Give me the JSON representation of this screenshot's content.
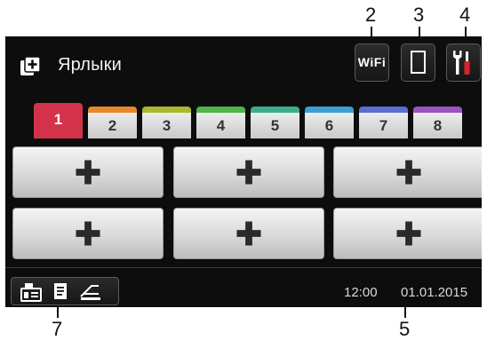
{
  "callouts": {
    "wifi": "2",
    "status": "3",
    "settings": "4",
    "datetime": "5",
    "modes": "7"
  },
  "header": {
    "title": "Ярлыки",
    "wifi_label": "WiFi",
    "icons": [
      "shortcuts-icon",
      "wifi-icon",
      "ink-status-icon",
      "settings-tools-icon"
    ]
  },
  "tabs": [
    {
      "label": "1",
      "color": "#d3334a",
      "active": true
    },
    {
      "label": "2",
      "color": "#e8872a"
    },
    {
      "label": "3",
      "color": "#a9b92c"
    },
    {
      "label": "4",
      "color": "#4fb449"
    },
    {
      "label": "5",
      "color": "#3aad8c"
    },
    {
      "label": "6",
      "color": "#3a9fd1"
    },
    {
      "label": "7",
      "color": "#5a6fd0"
    },
    {
      "label": "8",
      "color": "#9b52c4"
    }
  ],
  "shortcuts": [
    {
      "icon": "plus-icon"
    },
    {
      "icon": "plus-icon"
    },
    {
      "icon": "plus-icon"
    },
    {
      "icon": "plus-icon"
    },
    {
      "icon": "plus-icon"
    },
    {
      "icon": "plus-icon"
    }
  ],
  "status_bar": {
    "time": "12:00",
    "date": "01.01.2015",
    "mode_icons": [
      "fax-icon",
      "copy-icon",
      "scan-icon"
    ]
  }
}
